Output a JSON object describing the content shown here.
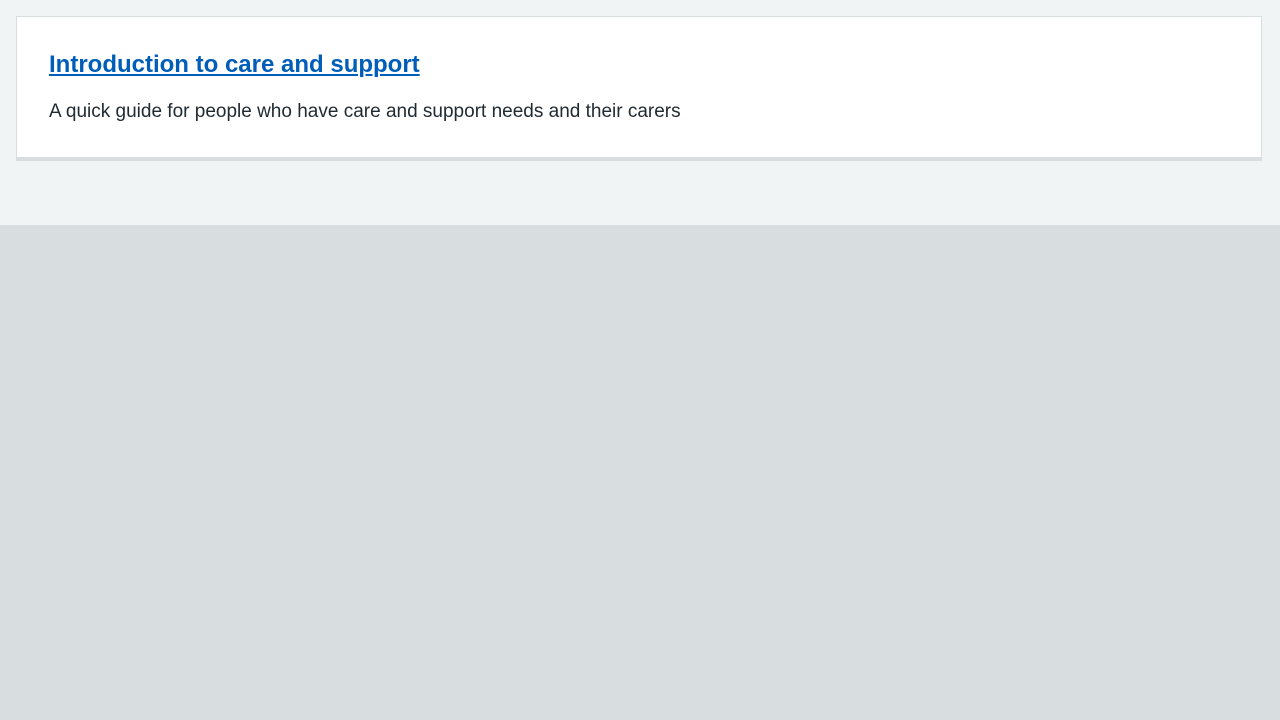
{
  "card": {
    "title": "Introduction to care and support",
    "description": "A quick guide for people who have care and support needs and their carers"
  },
  "colors": {
    "link": "#005eb8",
    "text": "#212b32",
    "page_bg": "#d8dde0",
    "band_bg": "#f0f4f5",
    "card_bg": "#ffffff",
    "card_border": "#d8dde0"
  }
}
